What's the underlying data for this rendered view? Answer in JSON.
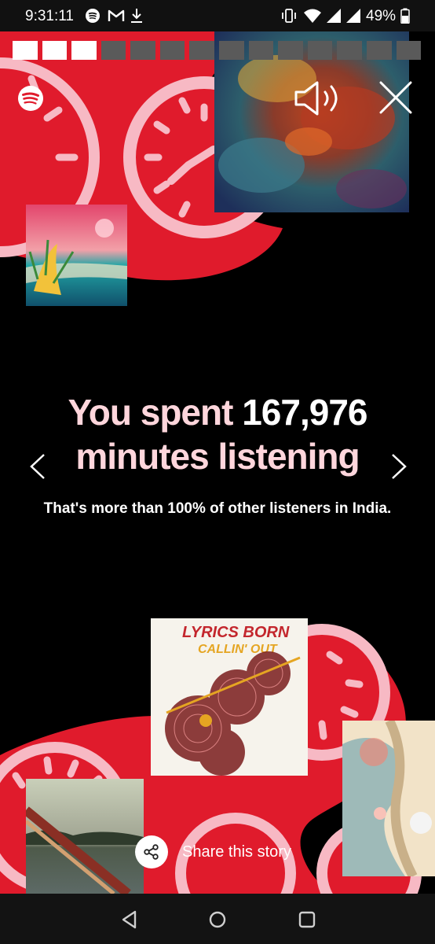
{
  "status_bar": {
    "time": "9:31:11",
    "battery_percent": "49%",
    "icons": [
      "spotify-icon",
      "gmail-icon",
      "download-icon",
      "vibrate-icon",
      "wifi-icon",
      "signal-icon",
      "battery-icon"
    ]
  },
  "story": {
    "segments_total": 14,
    "segments_done": 3,
    "headline_prefix": "You spent ",
    "headline_value": "167,976",
    "headline_suffix": "minutes listening",
    "subtext": "That's more than 100% of other listeners in India.",
    "share_label": "Share this story"
  },
  "colors": {
    "background": "#000000",
    "accent_red": "#e01b2c",
    "clock_pink": "#f7b9c4",
    "headline_pink": "#ffd6dc"
  }
}
